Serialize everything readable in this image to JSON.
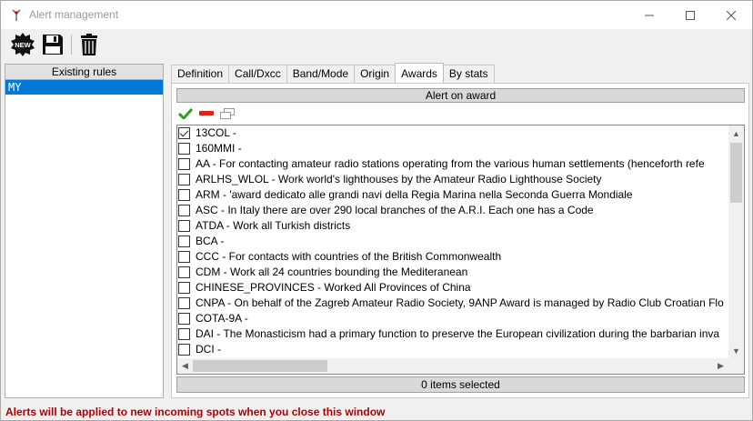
{
  "window": {
    "title": "Alert management"
  },
  "toolbar": {
    "new_label": "NEW"
  },
  "rules": {
    "header": "Existing rules",
    "items": [
      "MY"
    ]
  },
  "tabs": [
    "Definition",
    "Call/Dxcc",
    "Band/Mode",
    "Origin",
    "Awards",
    "By stats"
  ],
  "active_tab": "Awards",
  "awards": {
    "header": "Alert on award",
    "status": "0 items selected",
    "items": [
      {
        "text": "13COL -",
        "checked": true
      },
      {
        "text": "160MMI -",
        "checked": false
      },
      {
        "text": "AA - For contacting amateur radio stations operating from the various human settlements (henceforth refe",
        "checked": false
      },
      {
        "text": "ARLHS_WLOL - Work world's lighthouses by the Amateur Radio Lighthouse Society",
        "checked": false
      },
      {
        "text": "ARM - 'award dedicato alle grandi navi della Regia Marina nella Seconda Guerra Mondiale",
        "checked": false
      },
      {
        "text": "ASC - In Italy there are over 290 local branches of the A.R.I. Each one has a Code",
        "checked": false
      },
      {
        "text": "ATDA - Work all Turkish districts",
        "checked": false
      },
      {
        "text": "BCA -",
        "checked": false
      },
      {
        "text": "CCC - For contacts with countries of the British Commonwealth",
        "checked": false
      },
      {
        "text": "CDM - Work all 24 countries bounding the Mediteranean",
        "checked": false
      },
      {
        "text": "CHINESE_PROVINCES - Worked All Provinces of China",
        "checked": false
      },
      {
        "text": "CNPA - On behalf of the Zagreb Amateur Radio Society, 9ANP Award is managed by Radio Club Croatian Flo",
        "checked": false
      },
      {
        "text": "COTA-9A -",
        "checked": false
      },
      {
        "text": "DAI - The Monasticism had a primary function to preserve the European civilization during the barbarian inva",
        "checked": false
      },
      {
        "text": "DCI -",
        "checked": false
      }
    ]
  },
  "footer": {
    "note": "Alerts will be applied to new incoming spots when you close this window"
  },
  "colors": {
    "selection": "#0078d7",
    "footer_text": "#b00000"
  }
}
